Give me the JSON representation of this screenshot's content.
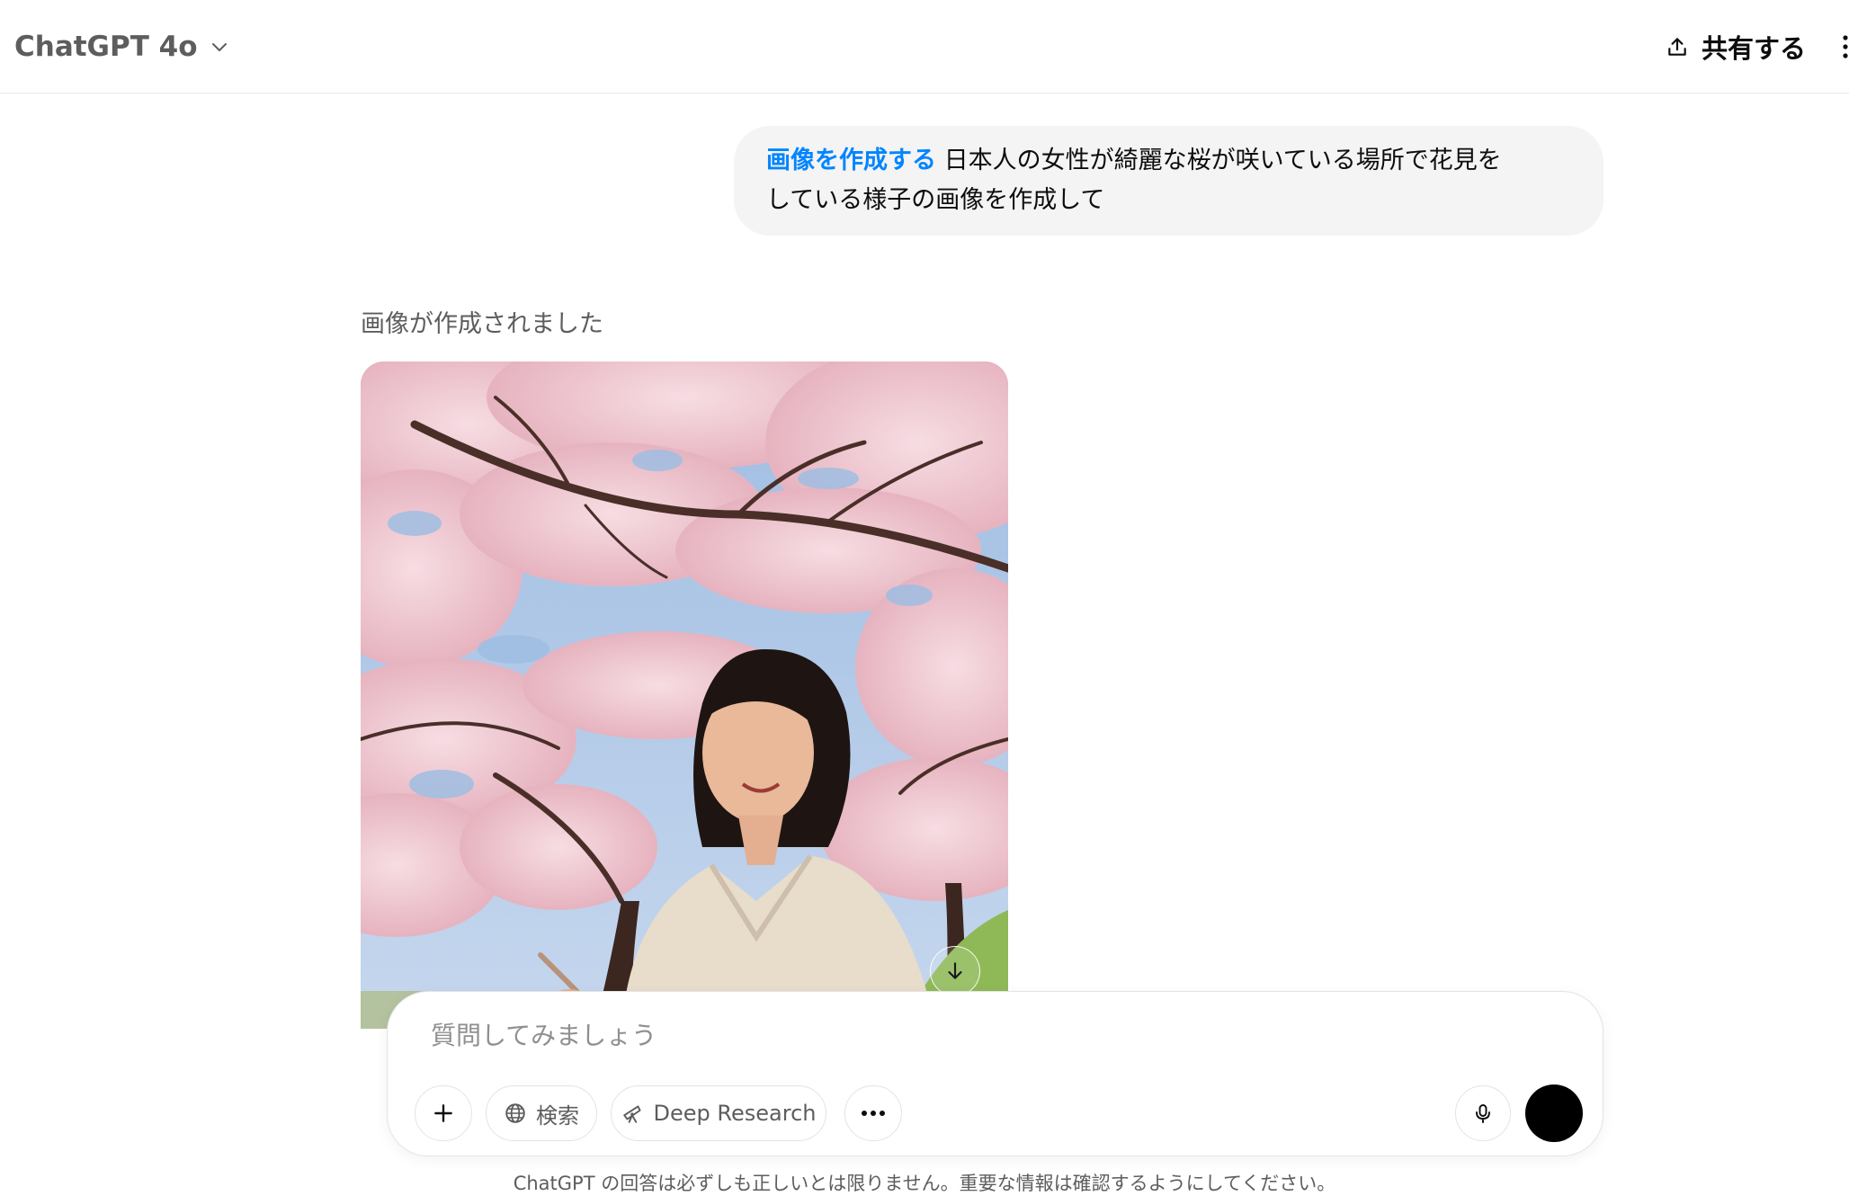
{
  "header": {
    "model_name": "ChatGPT 4o",
    "share_label": "共有する"
  },
  "user_message": {
    "tool_tag": "画像を作成する",
    "line1": " 日本人の女性が綺麗な桜が咲いている場所で花見を",
    "line2": "している様子の画像を作成して"
  },
  "assistant": {
    "status": "画像が作成されました"
  },
  "composer": {
    "placeholder": "質問してみましょう",
    "search_label": "検索",
    "deep_research_label": "Deep Research"
  },
  "footer": {
    "disclaimer": "ChatGPT の回答は必ずしも正しいとは限りません。重要な情報は確認するようにしてください。"
  },
  "icons": {
    "model_dropdown": "chevron-down-icon",
    "share": "upload-icon",
    "download": "download-arrow-icon",
    "plus": "plus-icon",
    "search": "globe-icon",
    "deep_research": "telescope-icon",
    "more": "ellipsis-icon",
    "mic": "microphone-icon"
  }
}
